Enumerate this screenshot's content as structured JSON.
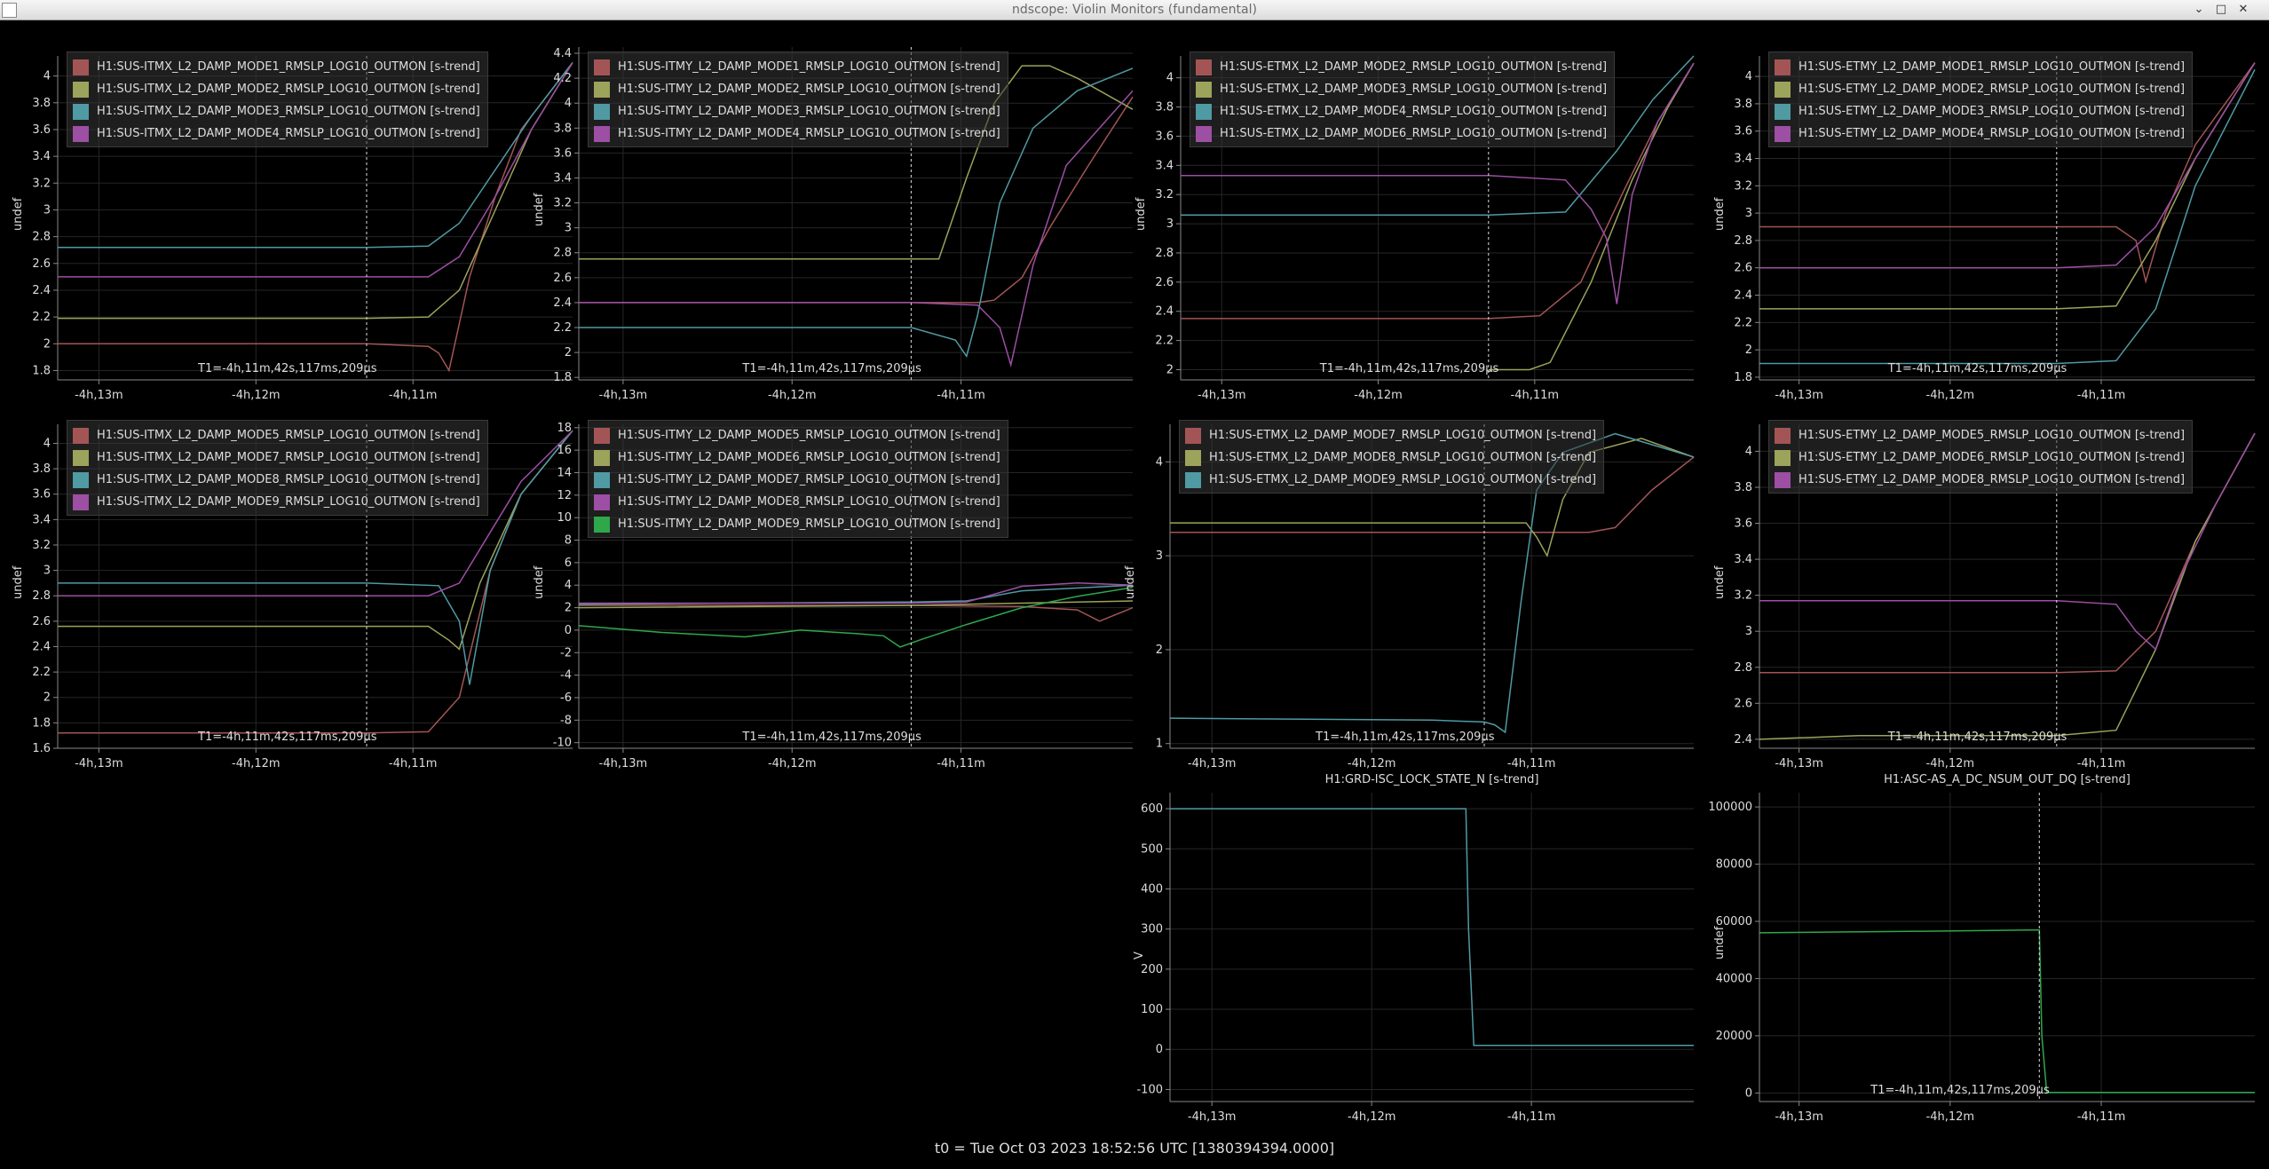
{
  "window": {
    "title": "ndscope: Violin Monitors (fundamental)",
    "close_glyph": "✕",
    "maximize_glyph": "□",
    "minimize_glyph": "⌄"
  },
  "status": {
    "t0": "t0 = Tue Oct 03 2023 18:52:56 UTC [1380394394.0000]"
  },
  "cursor_label": "T1=-4h,11m,42s,117ms,209µs",
  "x_ticks": [
    "-4h,13m",
    "-4h,12m",
    "-4h,11m"
  ],
  "colors": {
    "red": "#a35555",
    "olive": "#9ca35a",
    "teal": "#4f9aa3",
    "magenta": "#9c4fa3",
    "green": "#2ea84a",
    "bg": "#000000",
    "grid": "#262626",
    "axis": "#888888"
  },
  "chart_data": [
    {
      "id": "p1",
      "type": "line",
      "ylabel": "undef",
      "yticks": [
        "1.8",
        "2",
        "2.2",
        "2.4",
        "2.6",
        "2.8",
        "3",
        "3.2",
        "3.4",
        "3.6",
        "3.8",
        "4"
      ],
      "ylim": [
        1.73,
        4.15
      ],
      "series": [
        {
          "name": "H1:SUS-ITMX_L2_DAMP_MODE1_RMSLP_LOG10_OUTMON [s-trend]",
          "color": "red",
          "x": [
            0,
            0.6,
            0.72,
            0.74,
            0.76,
            0.8,
            0.85,
            0.9,
            1
          ],
          "y": [
            2.0,
            2.0,
            1.98,
            1.93,
            1.8,
            2.5,
            3.1,
            3.6,
            4.1
          ]
        },
        {
          "name": "H1:SUS-ITMX_L2_DAMP_MODE2_RMSLP_LOG10_OUTMON [s-trend]",
          "color": "olive",
          "x": [
            0,
            0.6,
            0.72,
            0.78,
            0.85,
            0.92,
            1
          ],
          "y": [
            2.19,
            2.19,
            2.2,
            2.4,
            3.0,
            3.6,
            4.1
          ]
        },
        {
          "name": "H1:SUS-ITMX_L2_DAMP_MODE3_RMSLP_LOG10_OUTMON [s-trend]",
          "color": "teal",
          "x": [
            0,
            0.6,
            0.72,
            0.78,
            0.85,
            0.92,
            1
          ],
          "y": [
            2.72,
            2.72,
            2.73,
            2.9,
            3.3,
            3.7,
            4.1
          ]
        },
        {
          "name": "H1:SUS-ITMX_L2_DAMP_MODE4_RMSLP_LOG10_OUTMON [s-trend]",
          "color": "magenta",
          "x": [
            0,
            0.6,
            0.72,
            0.78,
            0.85,
            0.92,
            1
          ],
          "y": [
            2.5,
            2.5,
            2.5,
            2.65,
            3.1,
            3.6,
            4.1
          ]
        }
      ]
    },
    {
      "id": "p2",
      "type": "line",
      "ylabel": "undef",
      "yticks": [
        "1.8",
        "2",
        "2.2",
        "2.4",
        "2.6",
        "2.8",
        "3",
        "3.2",
        "3.4",
        "3.6",
        "3.8",
        "4",
        "4.2",
        "4.4"
      ],
      "ylim": [
        1.78,
        4.45
      ],
      "series": [
        {
          "name": "H1:SUS-ITMY_L2_DAMP_MODE1_RMSLP_LOG10_OUTMON [s-trend]",
          "color": "red",
          "x": [
            0,
            0.6,
            0.72,
            0.75,
            0.8,
            0.85,
            0.92,
            1
          ],
          "y": [
            2.4,
            2.4,
            2.4,
            2.42,
            2.6,
            3.0,
            3.5,
            4.05
          ]
        },
        {
          "name": "H1:SUS-ITMY_L2_DAMP_MODE2_RMSLP_LOG10_OUTMON [s-trend]",
          "color": "olive",
          "x": [
            0,
            0.6,
            0.65,
            0.7,
            0.75,
            0.8,
            0.85,
            0.9,
            1
          ],
          "y": [
            2.75,
            2.75,
            2.75,
            3.4,
            4.0,
            4.3,
            4.3,
            4.2,
            3.95
          ]
        },
        {
          "name": "H1:SUS-ITMY_L2_DAMP_MODE3_RMSLP_LOG10_OUTMON [s-trend]",
          "color": "teal",
          "x": [
            0,
            0.6,
            0.68,
            0.7,
            0.72,
            0.76,
            0.82,
            0.9,
            1
          ],
          "y": [
            2.2,
            2.2,
            2.1,
            1.97,
            2.3,
            3.2,
            3.8,
            4.1,
            4.28
          ]
        },
        {
          "name": "H1:SUS-ITMY_L2_DAMP_MODE4_RMSLP_LOG10_OUTMON [s-trend]",
          "color": "magenta",
          "x": [
            0,
            0.6,
            0.72,
            0.76,
            0.78,
            0.82,
            0.88,
            1
          ],
          "y": [
            2.4,
            2.4,
            2.38,
            2.2,
            1.9,
            2.7,
            3.5,
            4.1
          ]
        }
      ]
    },
    {
      "id": "p3",
      "type": "line",
      "ylabel": "undef",
      "yticks": [
        "2",
        "2.2",
        "2.4",
        "2.6",
        "2.8",
        "3",
        "3.2",
        "3.4",
        "3.6",
        "3.8",
        "4"
      ],
      "ylim": [
        1.93,
        4.15
      ],
      "series": [
        {
          "name": "H1:SUS-ETMX_L2_DAMP_MODE2_RMSLP_LOG10_OUTMON [s-trend]",
          "color": "red",
          "x": [
            0,
            0.6,
            0.7,
            0.78,
            0.86,
            0.93,
            1
          ],
          "y": [
            2.35,
            2.35,
            2.37,
            2.6,
            3.2,
            3.7,
            4.1
          ]
        },
        {
          "name": "H1:SUS-ETMX_L2_DAMP_MODE3_RMSLP_LOG10_OUTMON [s-trend]",
          "color": "olive",
          "x": [
            0.6,
            0.68,
            0.72,
            0.8,
            0.88,
            0.95,
            1
          ],
          "y": [
            2.0,
            2.0,
            2.05,
            2.6,
            3.3,
            3.8,
            4.1
          ]
        },
        {
          "name": "H1:SUS-ETMX_L2_DAMP_MODE4_RMSLP_LOG10_OUTMON [s-trend]",
          "color": "teal",
          "x": [
            0,
            0.6,
            0.75,
            0.85,
            0.92,
            1
          ],
          "y": [
            3.06,
            3.06,
            3.08,
            3.5,
            3.85,
            4.15
          ]
        },
        {
          "name": "H1:SUS-ETMX_L2_DAMP_MODE6_RMSLP_LOG10_OUTMON [s-trend]",
          "color": "magenta",
          "x": [
            0,
            0.6,
            0.75,
            0.8,
            0.83,
            0.85,
            0.88,
            0.93,
            1
          ],
          "y": [
            3.33,
            3.33,
            3.3,
            3.1,
            2.9,
            2.45,
            3.2,
            3.7,
            4.1
          ]
        }
      ]
    },
    {
      "id": "p4",
      "type": "line",
      "ylabel": "undef",
      "yticks": [
        "1.8",
        "2",
        "2.2",
        "2.4",
        "2.6",
        "2.8",
        "3",
        "3.2",
        "3.4",
        "3.6",
        "3.8",
        "4"
      ],
      "ylim": [
        1.78,
        4.15
      ],
      "series": [
        {
          "name": "H1:SUS-ETMY_L2_DAMP_MODE1_RMSLP_LOG10_OUTMON [s-trend]",
          "color": "red",
          "x": [
            0,
            0.6,
            0.72,
            0.76,
            0.78,
            0.82,
            0.88,
            1
          ],
          "y": [
            2.9,
            2.9,
            2.9,
            2.8,
            2.5,
            3.0,
            3.5,
            4.1
          ]
        },
        {
          "name": "H1:SUS-ETMY_L2_DAMP_MODE2_RMSLP_LOG10_OUTMON [s-trend]",
          "color": "olive",
          "x": [
            0,
            0.6,
            0.72,
            0.8,
            0.88,
            1
          ],
          "y": [
            2.3,
            2.3,
            2.32,
            2.8,
            3.4,
            4.1
          ]
        },
        {
          "name": "H1:SUS-ETMY_L2_DAMP_MODE3_RMSLP_LOG10_OUTMON [s-trend]",
          "color": "teal",
          "x": [
            0,
            0.6,
            0.72,
            0.8,
            0.88,
            1
          ],
          "y": [
            1.9,
            1.9,
            1.92,
            2.3,
            3.2,
            4.05
          ]
        },
        {
          "name": "H1:SUS-ETMY_L2_DAMP_MODE4_RMSLP_LOG10_OUTMON [s-trend]",
          "color": "magenta",
          "x": [
            0,
            0.6,
            0.72,
            0.8,
            0.88,
            1
          ],
          "y": [
            2.6,
            2.6,
            2.62,
            2.9,
            3.4,
            4.1
          ]
        }
      ]
    },
    {
      "id": "p5",
      "type": "line",
      "ylabel": "undef",
      "yticks": [
        "1.6",
        "1.8",
        "2",
        "2.2",
        "2.4",
        "2.6",
        "2.8",
        "3",
        "3.2",
        "3.4",
        "3.6",
        "3.8",
        "4"
      ],
      "ylim": [
        1.6,
        4.15
      ],
      "series": [
        {
          "name": "H1:SUS-ITMX_L2_DAMP_MODE5_RMSLP_LOG10_OUTMON [s-trend]",
          "color": "red",
          "x": [
            0,
            0.6,
            0.72,
            0.78,
            0.84,
            0.9,
            1
          ],
          "y": [
            1.72,
            1.72,
            1.73,
            2.0,
            3.0,
            3.6,
            4.1
          ]
        },
        {
          "name": "H1:SUS-ITMX_L2_DAMP_MODE7_RMSLP_LOG10_OUTMON [s-trend]",
          "color": "olive",
          "x": [
            0,
            0.6,
            0.72,
            0.76,
            0.78,
            0.82,
            0.9,
            1
          ],
          "y": [
            2.56,
            2.56,
            2.56,
            2.45,
            2.38,
            2.9,
            3.6,
            4.1
          ]
        },
        {
          "name": "H1:SUS-ITMX_L2_DAMP_MODE8_RMSLP_LOG10_OUTMON [s-trend]",
          "color": "teal",
          "x": [
            0,
            0.6,
            0.74,
            0.78,
            0.8,
            0.84,
            0.9,
            1
          ],
          "y": [
            2.9,
            2.9,
            2.88,
            2.6,
            2.1,
            3.0,
            3.6,
            4.1
          ]
        },
        {
          "name": "H1:SUS-ITMX_L2_DAMP_MODE9_RMSLP_LOG10_OUTMON [s-trend]",
          "color": "magenta",
          "x": [
            0,
            0.6,
            0.72,
            0.78,
            0.84,
            0.9,
            1
          ],
          "y": [
            2.8,
            2.8,
            2.8,
            2.9,
            3.3,
            3.7,
            4.1
          ]
        }
      ]
    },
    {
      "id": "p6",
      "type": "line",
      "ylabel": "undef",
      "yticks": [
        "-10",
        "-8",
        "-6",
        "-4",
        "-2",
        "0",
        "2",
        "4",
        "6",
        "8",
        "10",
        "12",
        "14",
        "16",
        "18"
      ],
      "ylim": [
        -10.5,
        18.3
      ],
      "series": [
        {
          "name": "H1:SUS-ITMY_L2_DAMP_MODE5_RMSLP_LOG10_OUTMON [s-trend]",
          "color": "red",
          "x": [
            0,
            0.6,
            0.8,
            0.9,
            0.94,
            1
          ],
          "y": [
            2.2,
            2.2,
            2.1,
            1.8,
            0.8,
            2.0
          ]
        },
        {
          "name": "H1:SUS-ITMY_L2_DAMP_MODE6_RMSLP_LOG10_OUTMON [s-trend]",
          "color": "olive",
          "x": [
            0,
            0.6,
            0.8,
            1
          ],
          "y": [
            2.0,
            2.2,
            2.4,
            2.6
          ]
        },
        {
          "name": "H1:SUS-ITMY_L2_DAMP_MODE7_RMSLP_LOG10_OUTMON [s-trend]",
          "color": "teal",
          "x": [
            0,
            0.6,
            0.7,
            0.8,
            1
          ],
          "y": [
            2.3,
            2.5,
            2.6,
            3.5,
            4.0
          ]
        },
        {
          "name": "H1:SUS-ITMY_L2_DAMP_MODE8_RMSLP_LOG10_OUTMON [s-trend]",
          "color": "magenta",
          "x": [
            0,
            0.6,
            0.7,
            0.8,
            0.9,
            1
          ],
          "y": [
            2.4,
            2.4,
            2.5,
            3.9,
            4.2,
            4.0
          ]
        },
        {
          "name": "H1:SUS-ITMY_L2_DAMP_MODE9_RMSLP_LOG10_OUTMON [s-trend]",
          "color": "green",
          "x": [
            0,
            0.15,
            0.3,
            0.4,
            0.5,
            0.55,
            0.58,
            0.62,
            0.7,
            0.8,
            0.9,
            1
          ],
          "y": [
            0.4,
            -0.2,
            -0.6,
            0.0,
            -0.3,
            -0.5,
            -1.5,
            -0.8,
            0.5,
            2.0,
            3.0,
            3.8
          ]
        }
      ]
    },
    {
      "id": "p7",
      "type": "line",
      "ylabel": "undef",
      "yticks": [
        "1",
        "2",
        "3",
        "4"
      ],
      "ylim": [
        0.95,
        4.4
      ],
      "series": [
        {
          "name": "H1:SUS-ETMX_L2_DAMP_MODE7_RMSLP_LOG10_OUTMON [s-trend]",
          "color": "red",
          "x": [
            0,
            0.6,
            0.8,
            0.85,
            0.92,
            1
          ],
          "y": [
            3.25,
            3.25,
            3.25,
            3.3,
            3.7,
            4.05
          ]
        },
        {
          "name": "H1:SUS-ETMX_L2_DAMP_MODE8_RMSLP_LOG10_OUTMON [s-trend]",
          "color": "olive",
          "x": [
            0,
            0.6,
            0.68,
            0.7,
            0.72,
            0.75,
            0.8,
            0.9,
            1
          ],
          "y": [
            3.35,
            3.35,
            3.35,
            3.2,
            3.0,
            3.6,
            4.1,
            4.25,
            4.05
          ]
        },
        {
          "name": "H1:SUS-ETMX_L2_DAMP_MODE9_RMSLP_LOG10_OUTMON [s-trend]",
          "color": "teal",
          "x": [
            0,
            0.5,
            0.6,
            0.62,
            0.64,
            0.67,
            0.7,
            0.75,
            0.85,
            1
          ],
          "y": [
            1.27,
            1.25,
            1.23,
            1.2,
            1.12,
            2.5,
            3.7,
            4.1,
            4.3,
            4.05
          ]
        }
      ]
    },
    {
      "id": "p8",
      "type": "line",
      "ylabel": "undef",
      "yticks": [
        "2.4",
        "2.6",
        "2.8",
        "3",
        "3.2",
        "3.4",
        "3.6",
        "3.8",
        "4"
      ],
      "ylim": [
        2.35,
        4.15
      ],
      "series": [
        {
          "name": "H1:SUS-ETMY_L2_DAMP_MODE5_RMSLP_LOG10_OUTMON [s-trend]",
          "color": "red",
          "x": [
            0,
            0.6,
            0.72,
            0.8,
            0.88,
            1
          ],
          "y": [
            2.77,
            2.77,
            2.78,
            3.0,
            3.5,
            4.1
          ]
        },
        {
          "name": "H1:SUS-ETMY_L2_DAMP_MODE6_RMSLP_LOG10_OUTMON [s-trend]",
          "color": "olive",
          "x": [
            0,
            0.2,
            0.6,
            0.72,
            0.8,
            0.88,
            1
          ],
          "y": [
            2.4,
            2.42,
            2.42,
            2.45,
            2.9,
            3.5,
            4.1
          ]
        },
        {
          "name": "H1:SUS-ETMY_L2_DAMP_MODE8_RMSLP_LOG10_OUTMON [s-trend]",
          "color": "magenta",
          "x": [
            0,
            0.6,
            0.72,
            0.76,
            0.8,
            0.85,
            0.92,
            1
          ],
          "y": [
            3.17,
            3.17,
            3.15,
            3.0,
            2.9,
            3.3,
            3.7,
            4.1
          ]
        }
      ]
    },
    {
      "id": "p9",
      "type": "line",
      "title": "H1:GRD-ISC_LOCK_STATE_N [s-trend]",
      "ylabel": "V",
      "yticks": [
        "-100",
        "0",
        "100",
        "200",
        "300",
        "400",
        "500",
        "600"
      ],
      "ylim": [
        -130,
        640
      ],
      "series": [
        {
          "name": "",
          "color": "teal",
          "x": [
            0,
            0.565,
            0.57,
            0.58,
            1
          ],
          "y": [
            600,
            600,
            300,
            10,
            10
          ]
        }
      ]
    },
    {
      "id": "p10",
      "type": "line",
      "title": "H1:ASC-AS_A_DC_NSUM_OUT_DQ [s-trend]",
      "ylabel": "undef",
      "yticks": [
        "0",
        "20000",
        "40000",
        "60000",
        "80000",
        "100000"
      ],
      "ylim": [
        -3000,
        105000
      ],
      "series": [
        {
          "name": "",
          "color": "green",
          "x": [
            0,
            0.3,
            0.55,
            0.565,
            0.57,
            0.58,
            1
          ],
          "y": [
            56000,
            56500,
            57000,
            57000,
            20000,
            200,
            200
          ]
        }
      ]
    }
  ]
}
